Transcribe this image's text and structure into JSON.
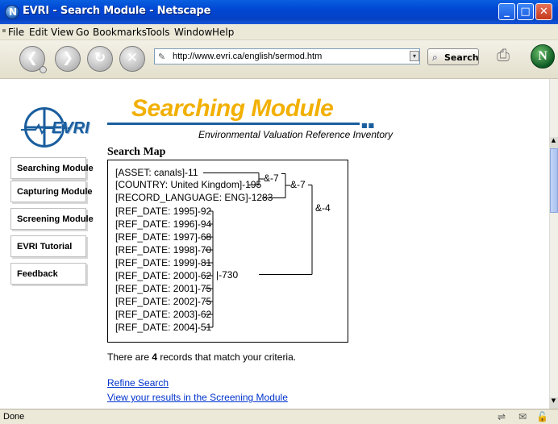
{
  "window": {
    "title": "EVRI - Search Module - Netscape",
    "controls": {
      "minimize": "_",
      "maximize": "□",
      "close": "✕"
    }
  },
  "menu": [
    "File",
    "Edit",
    "View",
    "Go",
    "Bookmarks",
    "Tools",
    "Window",
    "Help"
  ],
  "toolbar": {
    "back_icon": "back-arrow-icon",
    "forward_icon": "forward-arrow-icon",
    "reload_icon": "reload-icon",
    "stop_icon": "stop-icon",
    "url": "http://www.evri.ca/english/sermod.htm",
    "search_label": "Search"
  },
  "page": {
    "logo_text": "EVRI",
    "heading": "Searching Module",
    "subtitle": "Environmental Valuation Reference Inventory",
    "nav": [
      {
        "label": "Searching Module"
      },
      {
        "label": "Capturing Module"
      },
      {
        "label": "Screening Module"
      },
      {
        "label": "EVRI Tutorial"
      },
      {
        "label": "Feedback"
      }
    ],
    "search_map": {
      "title": "Search Map",
      "lines": [
        "[ASSET:  canals]-11",
        "[COUNTRY:  United Kingdom]-195",
        "[RECORD_LANGUAGE:  ENG]-1283",
        "[REF_DATE:  1995]-92",
        "[REF_DATE:  1996]-94",
        "[REF_DATE:  1997]-68",
        "[REF_DATE:  1998]-70",
        "[REF_DATE:  1999]-81",
        "[REF_DATE:  2000]-62",
        "[REF_DATE:  2001]-75",
        "[REF_DATE:  2002]-75",
        "[REF_DATE:  2003]-62",
        "[REF_DATE:  2004]-51"
      ],
      "operators": {
        "and1": "&-7",
        "and2": "&-7",
        "and3": "&-4",
        "or1": "|-730"
      }
    },
    "result": {
      "prefix": "There are ",
      "count": "4",
      "suffix": " records that match your criteria."
    },
    "links": {
      "refine": "Refine Search",
      "view": "View your results in the Screening Module"
    }
  },
  "status": {
    "text": "Done"
  },
  "colors": {
    "title_bar": "#0046d2",
    "heading": "#f2b000",
    "accent": "#1a5e9e",
    "link": "#0033cc"
  }
}
